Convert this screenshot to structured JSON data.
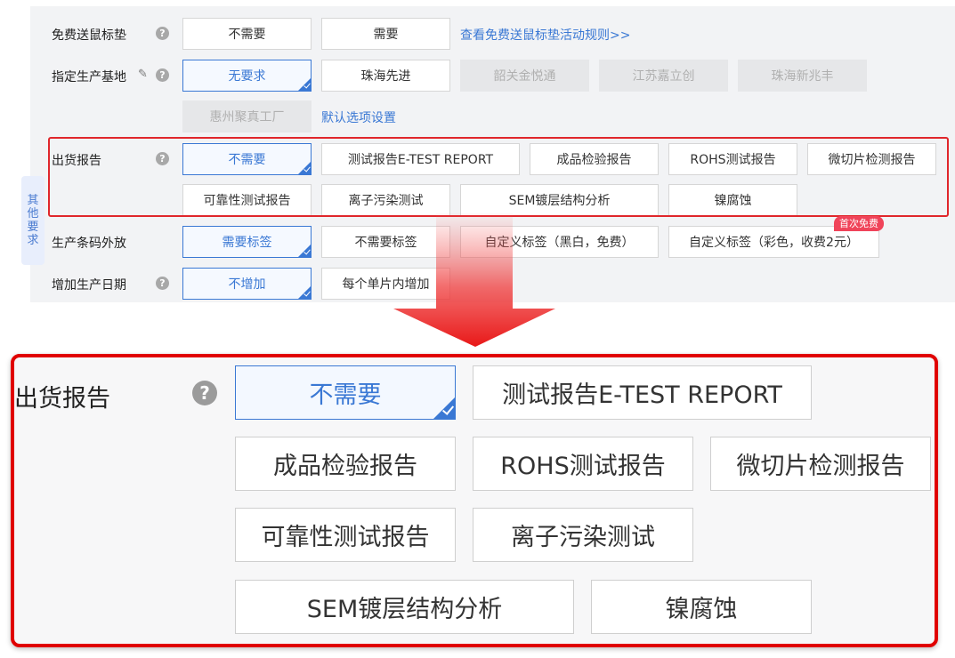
{
  "top": {
    "mousepad": {
      "label": "免费送鼠标垫",
      "options": [
        "不需要",
        "需要"
      ],
      "link": "查看免费送鼠标垫活动规则>>"
    },
    "base": {
      "label": "指定生产基地",
      "options": [
        "无要求",
        "珠海先进",
        "韶关金悦通",
        "江苏嘉立创",
        "珠海新兆丰",
        "惠州聚真工厂"
      ],
      "link": "默认选项设置"
    },
    "report": {
      "label": "出货报告",
      "options": [
        "不需要",
        "测试报告E-TEST REPORT",
        "成品检验报告",
        "ROHS测试报告",
        "微切片检测报告",
        "可靠性测试报告",
        "离子污染测试",
        "SEM镀层结构分析",
        "镍腐蚀"
      ]
    },
    "side_tab": [
      "其",
      "他",
      "要",
      "求"
    ],
    "barcode": {
      "label": "生产条码外放",
      "options": [
        "需要标签",
        "不需要标签",
        "自定义标签（黑白，免费）",
        "自定义标签（彩色，收费2元）"
      ],
      "badge": "首次免费"
    },
    "date": {
      "label": "增加生产日期",
      "options": [
        "不增加",
        "每个单片内增加"
      ]
    }
  },
  "zoom": {
    "label": "出货报告",
    "options": [
      "不需要",
      "测试报告E-TEST REPORT",
      "成品检验报告",
      "ROHS测试报告",
      "微切片检测报告",
      "可靠性测试报告",
      "离子污染测试",
      "SEM镀层结构分析",
      "镍腐蚀"
    ]
  },
  "colors": {
    "accent": "#3a78d4",
    "highlight": "#e0262b",
    "badge": "#f0445a"
  },
  "icons": {
    "help": "question-circle-icon",
    "edit": "pencil-icon",
    "check": "check-corner-icon",
    "arrow": "down-arrow-icon"
  }
}
